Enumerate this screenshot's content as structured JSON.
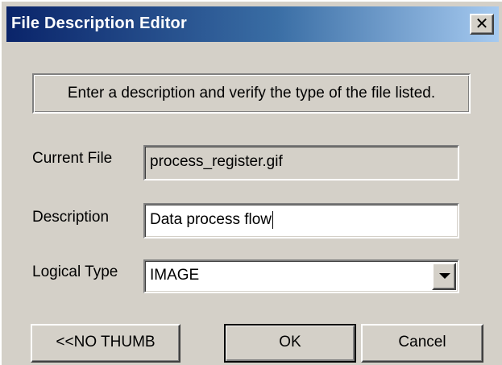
{
  "window": {
    "title": "File Description Editor",
    "close_glyph": "✕",
    "icons": {
      "close": "close-icon",
      "dropdown": "chevron-down-icon"
    }
  },
  "instruction": "Enter a description and verify the type of the file listed.",
  "fields": {
    "current_file": {
      "label": "Current File",
      "value": "process_register.gif"
    },
    "description": {
      "label": "Description",
      "value": "Data process flow"
    },
    "logical_type": {
      "label": "Logical Type",
      "value": "IMAGE"
    }
  },
  "buttons": {
    "no_thumb": "<<NO THUMB",
    "ok": "OK",
    "cancel": "Cancel"
  }
}
